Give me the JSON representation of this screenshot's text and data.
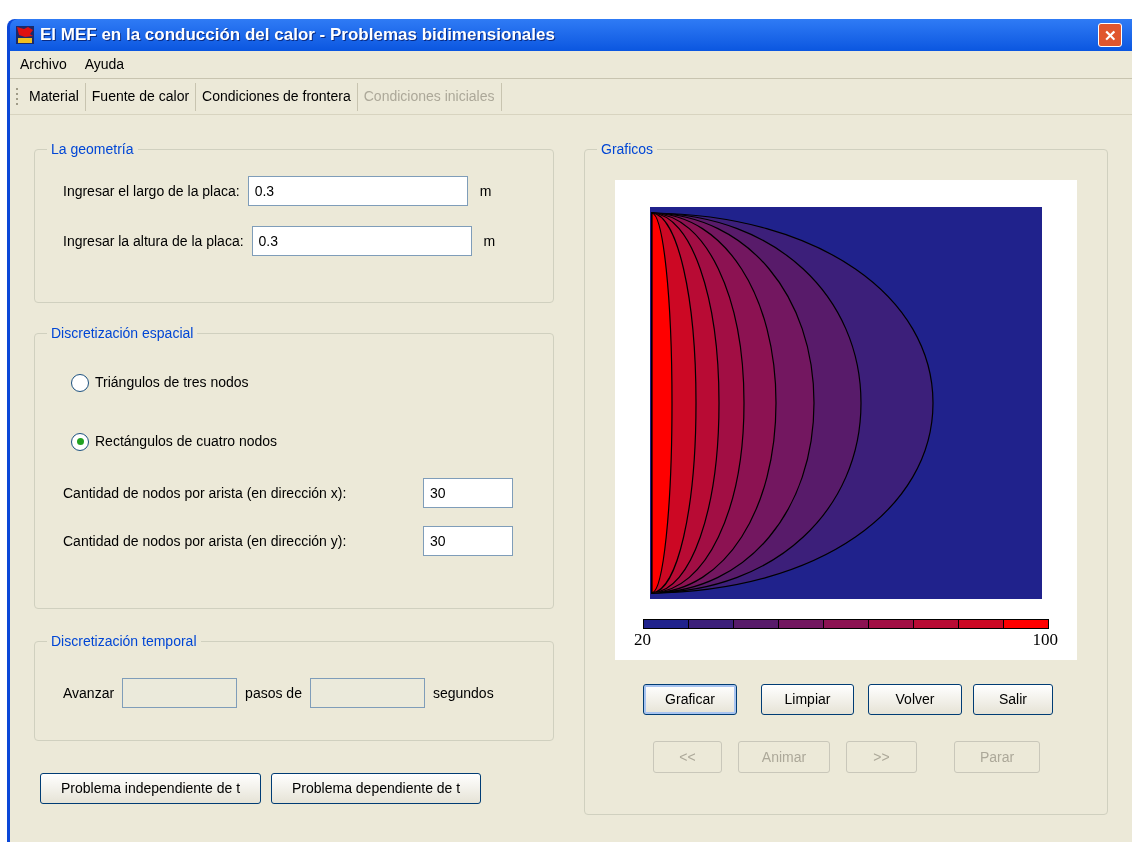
{
  "window": {
    "title": "El MEF en la conducción del calor - Problemas bidimensionales",
    "close": "✕"
  },
  "menu": [
    "Archivo",
    "Ayuda"
  ],
  "toolbar": [
    {
      "label": "Material",
      "disabled": false
    },
    {
      "label": "Fuente de calor",
      "disabled": false
    },
    {
      "label": "Condiciones de frontera",
      "disabled": false
    },
    {
      "label": "Condiciones iniciales",
      "disabled": true
    }
  ],
  "geometry": {
    "title": "La geometría",
    "fields": [
      {
        "label": "Ingresar el largo de la placa:",
        "value": "0.3",
        "unit": "m"
      },
      {
        "label": "Ingresar la altura de la placa:",
        "value": "0.3",
        "unit": "m"
      }
    ]
  },
  "spatial": {
    "title": "Discretización espacial",
    "options": [
      {
        "label": "Triángulos de tres nodos",
        "selected": false
      },
      {
        "label": "Rectángulos de cuatro nodos",
        "selected": true
      }
    ],
    "fields": [
      {
        "label": "Cantidad de nodos por arista (en dirección x):",
        "value": "30"
      },
      {
        "label": "Cantidad de nodos por arista (en dirección y):",
        "value": "30"
      }
    ]
  },
  "temporal": {
    "title": "Discretización temporal",
    "label_1": "Avanzar",
    "label_2": "pasos de",
    "label_3": "segundos",
    "disabled": true
  },
  "problem_buttons": [
    "Problema independiente de t",
    "Problema dependiente de t"
  ],
  "graphics": {
    "title": "Graficos",
    "legend_min": "20",
    "legend_max": "100",
    "buttons": [
      {
        "label": "Graficar",
        "disabled": false,
        "focused": true
      },
      {
        "label": "Limpiar",
        "disabled": false,
        "focused": false
      },
      {
        "label": "Volver",
        "disabled": false,
        "focused": false
      },
      {
        "label": "Salir",
        "disabled": false,
        "focused": false
      }
    ],
    "animation_buttons": [
      {
        "label": "<<",
        "disabled": true
      },
      {
        "label": "Animar",
        "disabled": true
      },
      {
        "label": ">>",
        "disabled": true
      },
      {
        "label": "Parar",
        "disabled": true
      }
    ]
  }
}
